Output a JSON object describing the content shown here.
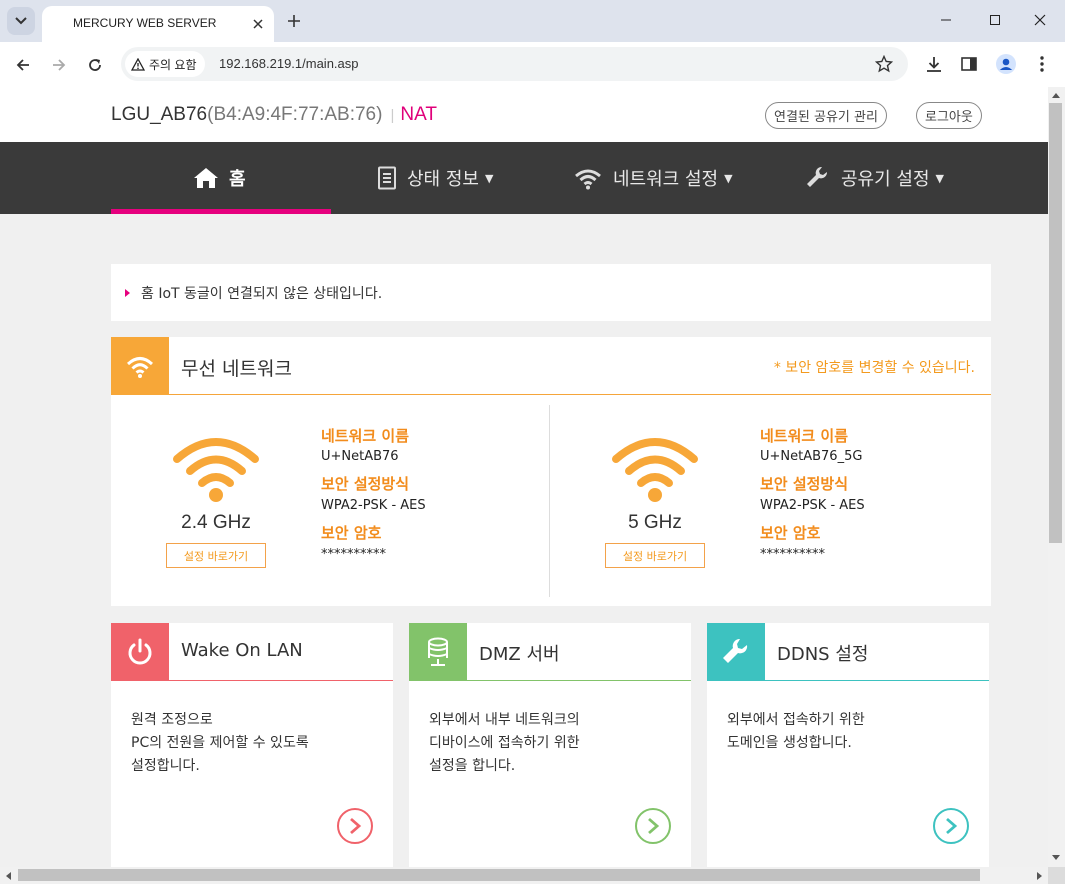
{
  "browser": {
    "tab_title": "MERCURY WEB SERVER",
    "security_chip": "주의 요함",
    "url": "192.168.219.1/main.asp"
  },
  "header": {
    "device_name": "LGU_AB76",
    "mac": "(B4:A9:4F:77:AB:76)",
    "separator": "|",
    "mode": "NAT",
    "manage_button": "연결된 공유기 관리",
    "logout_button": "로그아웃"
  },
  "nav": {
    "home": "홈",
    "status": "상태 정보",
    "network": "네트워크 설정",
    "router": "공유기 설정"
  },
  "notice": "홈 IoT 동글이 연결되지 않은 상태입니다.",
  "wireless": {
    "title": "무선 네트워크",
    "note": "* 보안 암호를 변경할 수 있습니다.",
    "bands": [
      {
        "freq": "2.4 GHz",
        "button": "설정 바로가기",
        "name_label": "네트워크 이름",
        "name": "U+NetAB76",
        "security_label": "보안 설정방식",
        "security": "WPA2-PSK - AES",
        "password_label": "보안 암호",
        "password": "**********"
      },
      {
        "freq": "5 GHz",
        "button": "설정 바로가기",
        "name_label": "네트워크 이름",
        "name": "U+NetAB76_5G",
        "security_label": "보안 설정방식",
        "security": "WPA2-PSK - AES",
        "password_label": "보안 암호",
        "password": "**********"
      }
    ]
  },
  "services": [
    {
      "title": "Wake On LAN",
      "desc": "원격 조정으로\nPC의 전원을 제어할 수 있도록\n설정합니다.",
      "color": "#f0626a"
    },
    {
      "title": "DMZ 서버",
      "desc": "외부에서 내부 네트워크의\n디바이스에 접속하기 위한\n설정을 합니다.",
      "color": "#82c36a"
    },
    {
      "title": "DDNS 설정",
      "desc": "외부에서 접속하기 위한\n도메인을 생성합니다.",
      "color": "#3dc2c0"
    }
  ],
  "colors": {
    "accent": "#e6007e",
    "wifi": "#f7a738",
    "nav_bg": "#3a3a3a"
  }
}
